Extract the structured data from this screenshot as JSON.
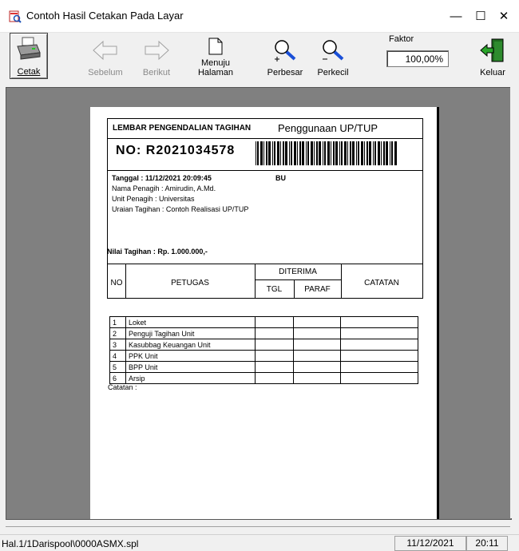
{
  "window": {
    "title": "Contoh Hasil Cetakan Pada Layar",
    "controls": {
      "minimize": "—",
      "maximize": "☐",
      "close": "✕"
    }
  },
  "toolbar": {
    "cetak": "Cetak",
    "sebelum": "Sebelum",
    "berikut": "Berikut",
    "menuju_line1": "Menuju",
    "menuju_line2": "Halaman",
    "perbesar": "Perbesar",
    "perkecil": "Perkecil",
    "faktor_label": "Faktor",
    "faktor_value": "100,00%",
    "keluar": "Keluar"
  },
  "document": {
    "header_title": "LEMBAR PENGENDALIAN TAGIHAN",
    "usage": "Penggunaan UP/TUP",
    "number": "NO: R2021034578",
    "tanggal": "Tanggal : 11/12/2021    20:09:45",
    "bu": "BU",
    "nama_penagih": "Nama Penagih  :  Amirudin, A.Md.",
    "unit_penagih": "Unit Penagih    :  Universitas",
    "uraian": "Uraian Tagihan : Contoh Realisasi UP/TUP",
    "nilai": "Nilai Tagihan :  Rp. 1.000.000,-",
    "columns": {
      "no": "NO",
      "petugas": "PETUGAS",
      "diterima": "DITERIMA",
      "tgl": "TGL",
      "paraf": "PARAF",
      "catatan": "CATATAN"
    },
    "rows": [
      {
        "no": "1",
        "petugas": "Loket"
      },
      {
        "no": "2",
        "petugas": "Penguji Tagihan Unit"
      },
      {
        "no": "3",
        "petugas": "Kasubbag Keuangan Unit"
      },
      {
        "no": "4",
        "petugas": "PPK Unit"
      },
      {
        "no": "5",
        "petugas": "BPP Unit"
      },
      {
        "no": "6",
        "petugas": "Arsip"
      }
    ],
    "catatan_label": "Catatan :"
  },
  "status": {
    "path": "Hal.1/1Darispool\\0000ASMX.spl",
    "date": "11/12/2021",
    "time": "20:11"
  },
  "colors": {
    "viewport_bg": "#808080",
    "window_bg": "#f0f0f0",
    "accent_icon": "#2a5bd7"
  }
}
